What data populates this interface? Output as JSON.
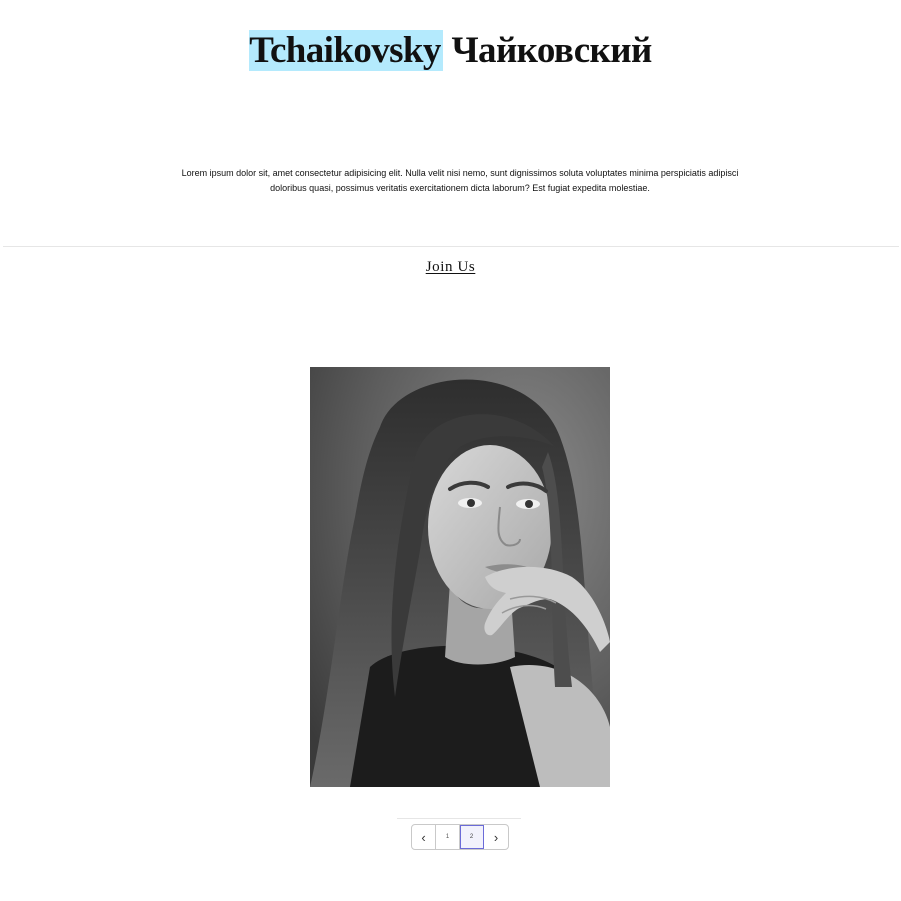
{
  "header": {
    "title_highlight": "Tchaikovsky",
    "title_rest": "Чайковский"
  },
  "intro": {
    "text": "Lorem ipsum dolor sit, amet consectetur adipisicing elit. Nulla velit nisi nemo, sunt dignissimos soluta voluptates minima perspiciatis adipisci doloribus quasi, possimus veritatis exercitationem dicta laborum? Est fugiat expedita molestiae."
  },
  "cta": {
    "join_label": "Join Us"
  },
  "pagination": {
    "prev_icon": "chevron-left-icon",
    "next_icon": "chevron-right-icon",
    "pages": [
      "1",
      "2"
    ],
    "current_page": "2"
  },
  "colors": {
    "highlight": "#b4eafd",
    "active_page_border": "#6b6bd8"
  }
}
